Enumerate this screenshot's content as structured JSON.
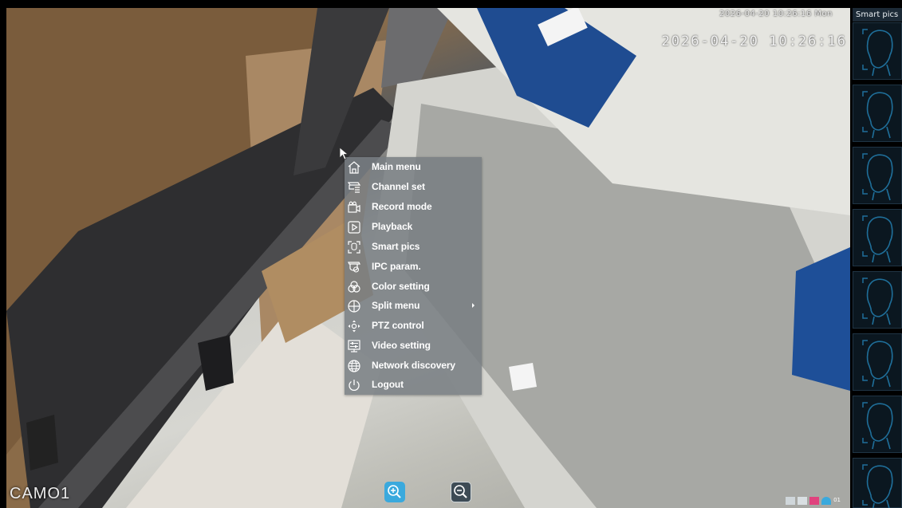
{
  "camera": {
    "osd_time_small": "2026-04-20 10:26:16 Mon",
    "osd_time_large": "2026-04-20 10:26:16",
    "label": "CAMO1"
  },
  "side_panel": {
    "title": "Smart pics",
    "slot_icon": "face-outline-icon"
  },
  "context_menu": {
    "items": [
      {
        "label": "Main menu",
        "icon": "home-icon"
      },
      {
        "label": "Channel set",
        "icon": "camera-settings-icon"
      },
      {
        "label": "Record mode",
        "icon": "video-camera-icon"
      },
      {
        "label": "Playback",
        "icon": "play-icon"
      },
      {
        "label": "Smart pics",
        "icon": "face-frame-icon"
      },
      {
        "label": "IPC param.",
        "icon": "ipc-camera-icon"
      },
      {
        "label": "Color setting",
        "icon": "color-circles-icon"
      },
      {
        "label": "Split menu",
        "icon": "split-grid-icon",
        "has_submenu": true
      },
      {
        "label": "PTZ control",
        "icon": "ptz-arrows-icon"
      },
      {
        "label": "Video setting",
        "icon": "video-sliders-icon"
      },
      {
        "label": "Network discovery",
        "icon": "globe-icon"
      },
      {
        "label": "Logout",
        "icon": "power-icon"
      }
    ]
  },
  "toolbar": {
    "zoom_in_icon": "zoom-in-icon",
    "zoom_out_icon": "zoom-out-icon"
  },
  "colors": {
    "zoom_in_bg": "#3aa9dd",
    "panel_accent": "#1f6f9a",
    "menu_bg": "#7a8084"
  },
  "status_number": "01"
}
